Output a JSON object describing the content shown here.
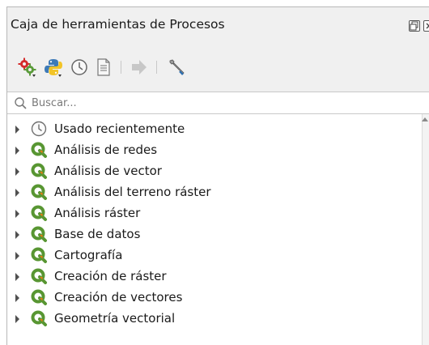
{
  "panel": {
    "title": "Caja de herramientas de Procesos"
  },
  "toolbar": {
    "items": [
      {
        "name": "models-icon"
      },
      {
        "name": "python-scripts-icon"
      },
      {
        "name": "history-icon"
      },
      {
        "name": "results-viewer-icon"
      },
      {
        "name": "edit-features-in-place-icon"
      },
      {
        "name": "options-icon"
      }
    ]
  },
  "search": {
    "placeholder": "Buscar..."
  },
  "tree": {
    "items": [
      {
        "label": "Usado recientemente",
        "icon": "clock-icon"
      },
      {
        "label": "Análisis de redes",
        "icon": "qgis-logo-icon"
      },
      {
        "label": "Análisis de vector",
        "icon": "qgis-logo-icon"
      },
      {
        "label": "Análisis del terreno ráster",
        "icon": "qgis-logo-icon"
      },
      {
        "label": "Análisis ráster",
        "icon": "qgis-logo-icon"
      },
      {
        "label": "Base de datos",
        "icon": "qgis-logo-icon"
      },
      {
        "label": "Cartografía",
        "icon": "qgis-logo-icon"
      },
      {
        "label": "Creación de ráster",
        "icon": "qgis-logo-icon"
      },
      {
        "label": "Creación de vectores",
        "icon": "qgis-logo-icon"
      },
      {
        "label": "Geometría vectorial",
        "icon": "qgis-logo-icon"
      }
    ]
  },
  "colors": {
    "qgis_green": "#589632",
    "qgis_yellow": "#ee7913"
  }
}
